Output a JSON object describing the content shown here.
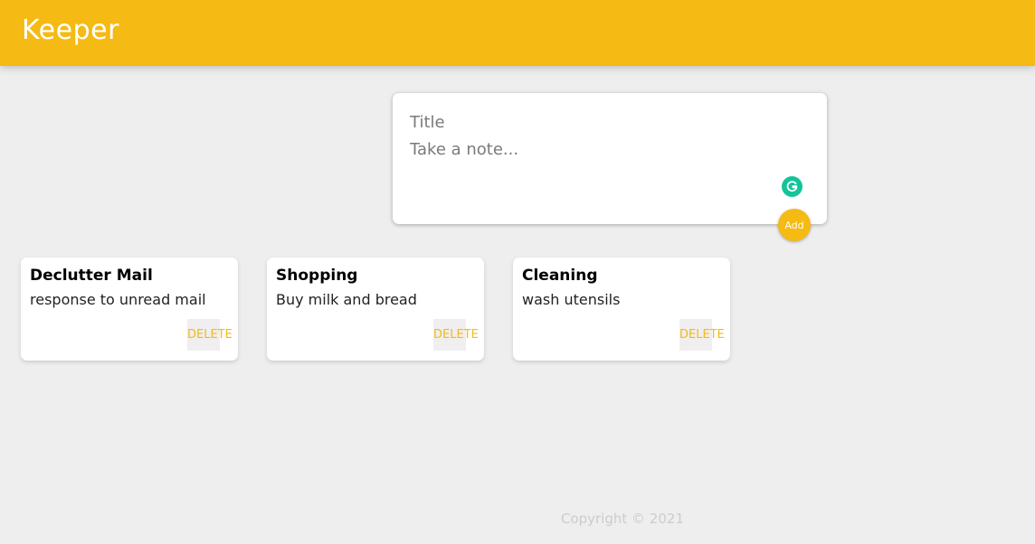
{
  "header": {
    "brand": "Keeper"
  },
  "create_form": {
    "title_placeholder": "Title",
    "content_placeholder": "Take a note...",
    "add_label": "Add"
  },
  "notes": [
    {
      "title": "Declutter Mail",
      "content": "response to unread mail",
      "delete_label": "DELETE"
    },
    {
      "title": "Shopping",
      "content": "Buy milk and bread",
      "delete_label": "DELETE"
    },
    {
      "title": "Cleaning",
      "content": "wash utensils",
      "delete_label": "DELETE"
    }
  ],
  "footer": {
    "copyright": "Copyright © 2021"
  },
  "colors": {
    "accent": "#f5ba13",
    "background": "#eeeeee",
    "grammarly": "#15c39a"
  },
  "icons": {
    "extension": "grammarly-icon"
  }
}
